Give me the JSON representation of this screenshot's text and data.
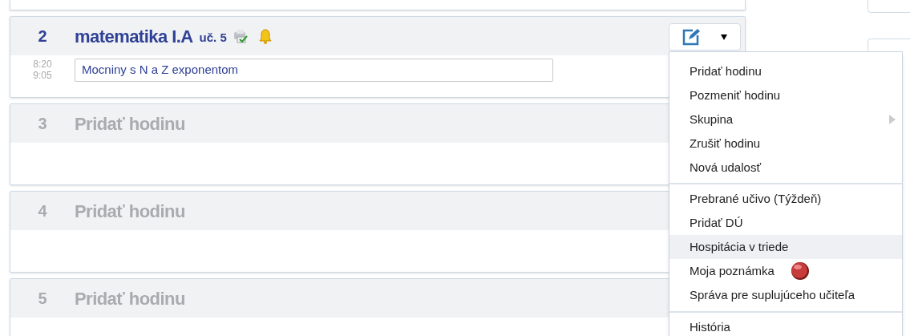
{
  "lessons": [
    {
      "number": "2",
      "kind": "lesson",
      "subject": "matematika I.A",
      "room": "uč. 5",
      "start": "8:20",
      "end": "9:05",
      "topic": "Mocniny s N a Z exponentom"
    },
    {
      "number": "3",
      "kind": "empty",
      "subject": "Pridať hodinu"
    },
    {
      "number": "4",
      "kind": "empty",
      "subject": "Pridať hodinu"
    },
    {
      "number": "5",
      "kind": "empty",
      "subject": "Pridať hodinu"
    }
  ],
  "menu": {
    "groups": [
      [
        {
          "label": "Pridať hodinu",
          "submenu": false,
          "pin": false,
          "selected": false
        },
        {
          "label": "Pozmeniť hodinu",
          "submenu": false,
          "pin": false,
          "selected": false
        },
        {
          "label": "Skupina",
          "submenu": true,
          "pin": false,
          "selected": false
        },
        {
          "label": "Zrušiť hodinu",
          "submenu": false,
          "pin": false,
          "selected": false
        },
        {
          "label": "Nová udalosť",
          "submenu": false,
          "pin": false,
          "selected": false
        }
      ],
      [
        {
          "label": "Prebrané učivo (Týždeň)",
          "submenu": false,
          "pin": false,
          "selected": false
        },
        {
          "label": "Pridať DÚ",
          "submenu": false,
          "pin": false,
          "selected": false
        },
        {
          "label": "Hospitácia v triede",
          "submenu": false,
          "pin": false,
          "selected": true
        },
        {
          "label": "Moja poznámka",
          "submenu": false,
          "pin": true,
          "selected": false
        },
        {
          "label": "Správa pre suplujúceho učiteľa",
          "submenu": false,
          "pin": false,
          "selected": false
        }
      ],
      [
        {
          "label": "História",
          "submenu": false,
          "pin": false,
          "selected": false
        }
      ]
    ]
  }
}
